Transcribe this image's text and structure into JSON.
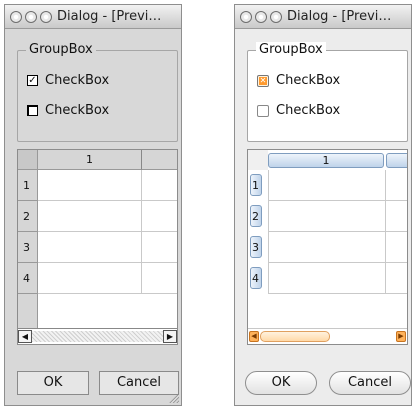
{
  "dialogs": [
    {
      "title": "Dialog - [Previ…",
      "groupbox_title": "GroupBox",
      "checkboxes": [
        {
          "label": "CheckBox",
          "checked": true
        },
        {
          "label": "CheckBox",
          "checked": false
        }
      ],
      "table": {
        "column_headers": [
          "1"
        ],
        "row_headers": [
          "1",
          "2",
          "3",
          "4"
        ]
      },
      "buttons": {
        "ok": "OK",
        "cancel": "Cancel"
      }
    },
    {
      "title": "Dialog - [Previ…",
      "groupbox_title": "GroupBox",
      "checkboxes": [
        {
          "label": "CheckBox",
          "checked": true
        },
        {
          "label": "CheckBox",
          "checked": false
        }
      ],
      "table": {
        "column_headers": [
          "1"
        ],
        "row_headers": [
          "1",
          "2",
          "3",
          "4"
        ]
      },
      "buttons": {
        "ok": "OK",
        "cancel": "Cancel"
      }
    }
  ],
  "icons": {
    "window_controls": [
      "close-button-icon",
      "minimize-button-icon",
      "zoom-button-icon"
    ],
    "scroll_left": "◀",
    "scroll_right": "▶"
  },
  "colors": {
    "style_a_background": "#d8d8d8",
    "style_b_accent": "#ff9a2e",
    "style_b_header": "#bfd3ea"
  }
}
